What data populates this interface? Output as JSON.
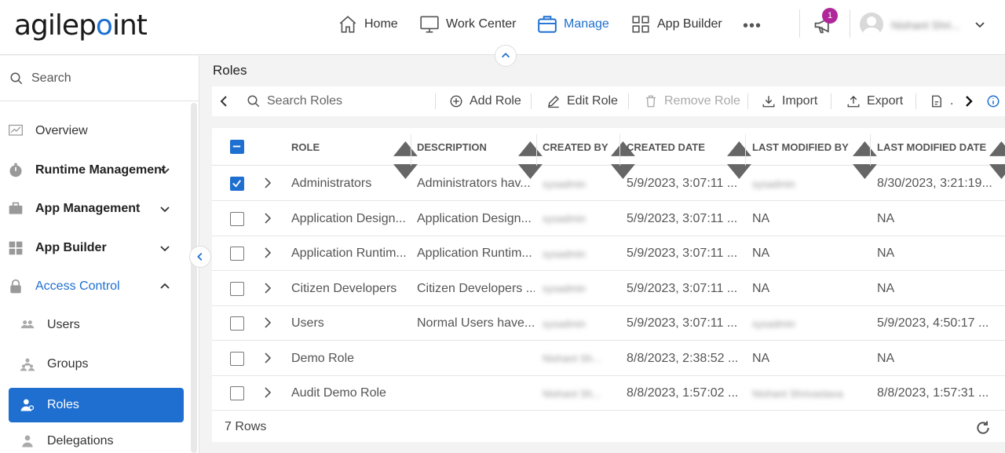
{
  "brand": {
    "logo_pre": "agilep",
    "logo_dot": "o",
    "logo_post": "int"
  },
  "nav": {
    "home": "Home",
    "work_center": "Work Center",
    "manage": "Manage",
    "app_builder": "App Builder",
    "more": "•••",
    "notification_count": "1",
    "user_name": "Nishant Shri..."
  },
  "sidebar": {
    "search_label": "Search",
    "items": [
      {
        "label": "Overview",
        "icon": "chart-icon"
      },
      {
        "label": "Runtime Management",
        "icon": "stopwatch-icon"
      },
      {
        "label": "App Management",
        "icon": "briefcase-icon"
      },
      {
        "label": "App Builder",
        "icon": "grid-icon"
      },
      {
        "label": "Access Control",
        "icon": "lock-icon"
      }
    ],
    "subitems": [
      {
        "label": "Users",
        "icon": "users-icon"
      },
      {
        "label": "Groups",
        "icon": "groups-icon"
      },
      {
        "label": "Roles",
        "icon": "roles-icon"
      },
      {
        "label": "Delegations",
        "icon": "delegations-icon"
      }
    ]
  },
  "main": {
    "title": "Roles",
    "toolbar": {
      "search_placeholder": "Search Roles",
      "add": "Add Role",
      "edit": "Edit Role",
      "remove": "Remove Role",
      "import": "Import",
      "export": "Export",
      "truncated": "."
    },
    "columns": [
      "ROLE",
      "DESCRIPTION",
      "CREATED BY",
      "CREATED DATE",
      "LAST MODIFIED BY",
      "LAST MODIFIED DATE"
    ],
    "rows": [
      {
        "checked": true,
        "role": "Administrators",
        "description": "Administrators hav...",
        "created_by": "sysadmin",
        "created_date": "5/9/2023, 3:07:11 ...",
        "modified_by": "sysadmin",
        "modified_by_blur": true,
        "modified_date": "8/30/2023, 3:21:19..."
      },
      {
        "checked": false,
        "role": "Application Design...",
        "description": "Application Design...",
        "created_by": "sysadmin",
        "created_date": "5/9/2023, 3:07:11 ...",
        "modified_by": "NA",
        "modified_by_blur": false,
        "modified_date": "NA"
      },
      {
        "checked": false,
        "role": "Application Runtim...",
        "description": "Application Runtim...",
        "created_by": "sysadmin",
        "created_date": "5/9/2023, 3:07:11 ...",
        "modified_by": "NA",
        "modified_by_blur": false,
        "modified_date": "NA"
      },
      {
        "checked": false,
        "role": "Citizen Developers",
        "description": "Citizen Developers ...",
        "created_by": "sysadmin",
        "created_date": "5/9/2023, 3:07:11 ...",
        "modified_by": "NA",
        "modified_by_blur": false,
        "modified_date": "NA"
      },
      {
        "checked": false,
        "role": "Users",
        "description": "Normal Users have...",
        "created_by": "sysadmin",
        "created_date": "5/9/2023, 3:07:11 ...",
        "modified_by": "sysadmin",
        "modified_by_blur": true,
        "modified_date": "5/9/2023, 4:50:17 ..."
      },
      {
        "checked": false,
        "role": "Demo Role",
        "description": "",
        "created_by": "Nishant Sh...",
        "created_date": "8/8/2023, 2:38:52 ...",
        "modified_by": "NA",
        "modified_by_blur": false,
        "modified_date": "NA"
      },
      {
        "checked": false,
        "role": "Audit Demo Role",
        "description": "",
        "created_by": "Nishant Sh...",
        "created_date": "8/8/2023, 1:57:02 ...",
        "modified_by": "Nishant Shrivastava",
        "modified_by_blur": true,
        "modified_date": "8/8/2023, 1:57:31 ..."
      }
    ],
    "row_count": "7 Rows"
  },
  "colors": {
    "accent": "#1e6fd0",
    "badge": "#b0279a"
  }
}
